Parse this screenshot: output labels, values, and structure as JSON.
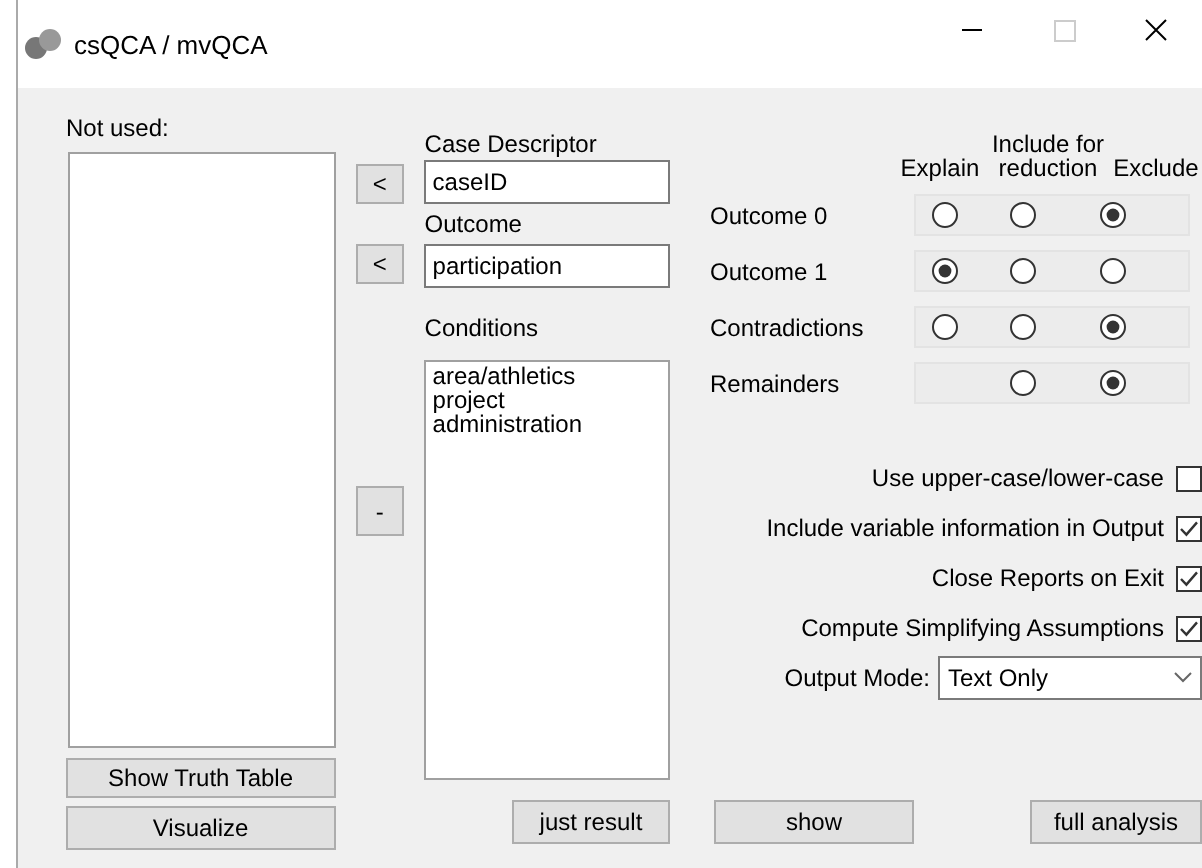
{
  "window": {
    "title": "csQCA / mvQCA",
    "maximize_disabled": true
  },
  "not_used": {
    "label": "Not used:"
  },
  "left_buttons": [
    "Show Truth Table",
    "Visualize"
  ],
  "case_descriptor": {
    "label": "Case Descriptor",
    "value": "caseID",
    "move_button": "<"
  },
  "outcome": {
    "label": "Outcome",
    "value": "participation",
    "move_button": "<"
  },
  "conditions": {
    "label": "Conditions",
    "items": [
      "area/athletics",
      "project",
      "administration"
    ],
    "remove_button": "-"
  },
  "treatment": {
    "columns": [
      "Explain",
      "Include for reduction",
      "Exclude"
    ],
    "rows": [
      {
        "label": "Outcome 0",
        "options": [
          {
            "selected": false
          },
          {
            "selected": false
          },
          {
            "selected": true
          }
        ]
      },
      {
        "label": "Outcome 1",
        "options": [
          {
            "selected": true
          },
          {
            "selected": false
          },
          {
            "selected": false
          }
        ]
      },
      {
        "label": "Contradictions",
        "options": [
          {
            "selected": false
          },
          {
            "selected": false
          },
          {
            "selected": true
          }
        ]
      },
      {
        "label": "Remainders",
        "options": [
          {
            "selected": false
          },
          {
            "selected": true
          }
        ]
      }
    ]
  },
  "options": [
    {
      "label": "Use upper-case/lower-case",
      "checked": false
    },
    {
      "label": "Include variable information in Output",
      "checked": true
    },
    {
      "label": "Close Reports on Exit",
      "checked": true
    },
    {
      "label": "Compute Simplifying Assumptions",
      "checked": true
    }
  ],
  "output_mode": {
    "label": "Output Mode:",
    "value": "Text Only"
  },
  "bottom_buttons": [
    "just result",
    "show",
    "full analysis"
  ]
}
